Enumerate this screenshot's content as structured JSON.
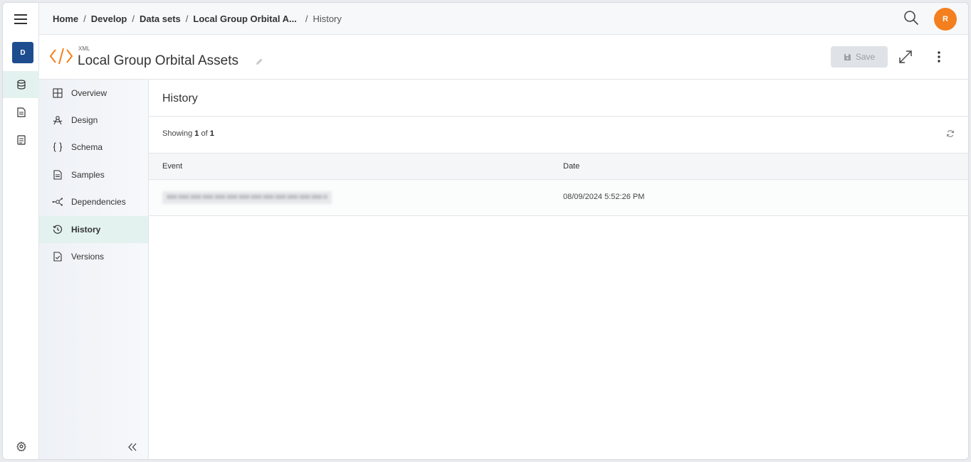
{
  "breadcrumb": {
    "items": [
      "Home",
      "Develop",
      "Data sets",
      "Local Group Orbital A..."
    ],
    "separator": "/",
    "current": "History"
  },
  "user": {
    "initial": "R",
    "avatar_color": "#f47f1e"
  },
  "rail": {
    "badge": "D",
    "badge_color": "#1d4d8f"
  },
  "dataset": {
    "type_label": "XML",
    "title": "Local Group Orbital Assets"
  },
  "toolbar": {
    "save_label": "Save"
  },
  "subnav": {
    "items": [
      {
        "label": "Overview",
        "icon": "grid-icon"
      },
      {
        "label": "Design",
        "icon": "design-icon"
      },
      {
        "label": "Schema",
        "icon": "braces-icon"
      },
      {
        "label": "Samples",
        "icon": "document-icon"
      },
      {
        "label": "Dependencies",
        "icon": "nodes-icon"
      },
      {
        "label": "History",
        "icon": "history-icon"
      },
      {
        "label": "Versions",
        "icon": "file-check-icon"
      }
    ],
    "active": "History"
  },
  "main": {
    "title": "History",
    "showing_prefix": "Showing",
    "showing_current": "1",
    "showing_of": "of",
    "showing_total": "1",
    "columns": [
      "Event",
      "Date"
    ],
    "rows": [
      {
        "event": "",
        "date": "08/09/2024 5:52:26 PM"
      }
    ]
  },
  "colors": {
    "accent_orange": "#f47f1e",
    "active_bg": "#e3f2ef",
    "badge_blue": "#1d4d8f"
  }
}
